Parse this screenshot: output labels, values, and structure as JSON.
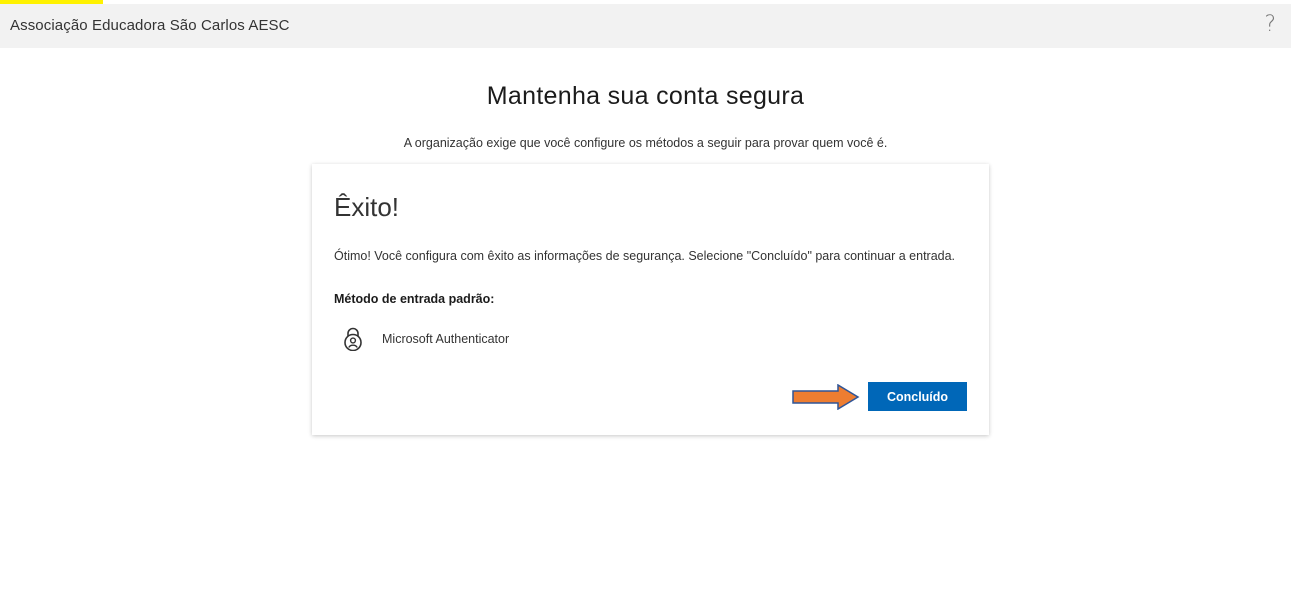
{
  "header": {
    "org_name": "Associação Educadora São Carlos AESC",
    "help_glyph": "?"
  },
  "page": {
    "title": "Mantenha sua conta segura",
    "subtitle": "A organização exige que você configure os métodos a seguir para provar quem você é."
  },
  "card": {
    "title": "Êxito!",
    "message": "Ótimo! Você configura com êxito as informações de segurança. Selecione \"Concluído\" para continuar a entrada.",
    "default_method_label": "Método de entrada padrão:",
    "method_icon": "authenticator-lock-icon",
    "method_name": "Microsoft Authenticator",
    "done_label": "Concluído"
  },
  "colors": {
    "header_bg": "#f2f2f2",
    "primary_button": "#0067b8",
    "arrow_fill": "#ed7d31",
    "arrow_stroke": "#2f5597",
    "highlight": "#fff200"
  }
}
